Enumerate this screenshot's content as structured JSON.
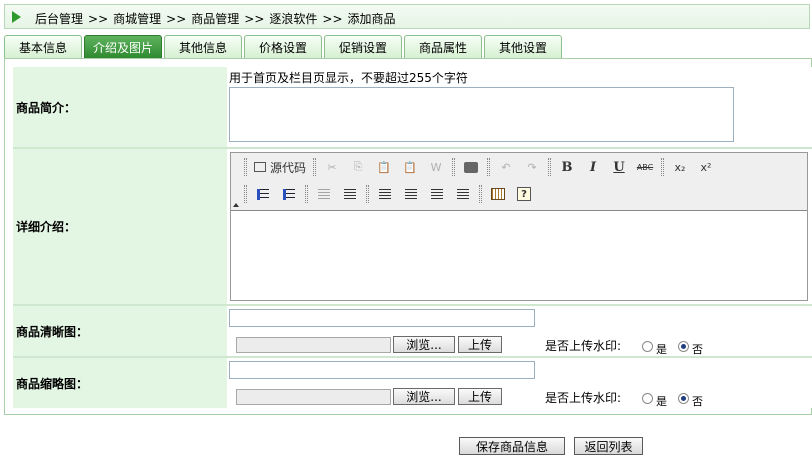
{
  "breadcrumb": {
    "items": [
      "后台管理",
      "商城管理",
      "商品管理",
      "逐浪软件",
      "添加商品"
    ],
    "separator": ">>"
  },
  "tabs": [
    {
      "label": "基本信息",
      "active": false
    },
    {
      "label": "介绍及图片",
      "active": true
    },
    {
      "label": "其他信息",
      "active": false
    },
    {
      "label": "价格设置",
      "active": false
    },
    {
      "label": "促销设置",
      "active": false
    },
    {
      "label": "商品属性",
      "active": false
    },
    {
      "label": "其他设置",
      "active": false
    }
  ],
  "intro": {
    "label": "商品简介：",
    "hint": "用于首页及栏目页显示，不要超过255个字符",
    "value": ""
  },
  "detail": {
    "label": "详细介绍：",
    "source_button": "源代码",
    "toolbar": {
      "bold": "B",
      "italic": "I",
      "underline": "U",
      "strike": "ABC",
      "subscript": "x₂",
      "superscript": "x²",
      "help": "?"
    }
  },
  "clear_image": {
    "label": "商品清晰图：",
    "url_value": "",
    "browse_label": "浏览...",
    "upload_label": "上传",
    "watermark_label": "是否上传水印:",
    "option_yes": "是",
    "option_no": "否",
    "watermark": "no"
  },
  "thumb_image": {
    "label": "商品缩略图：",
    "url_value": "",
    "browse_label": "浏览...",
    "upload_label": "上传",
    "watermark_label": "是否上传水印:",
    "option_yes": "是",
    "option_no": "否",
    "watermark": "no"
  },
  "actions": {
    "save": "保存商品信息",
    "back": "返回列表"
  },
  "colors": {
    "accent": "#2f8a2f",
    "label_bg": "#e3f5e3"
  }
}
